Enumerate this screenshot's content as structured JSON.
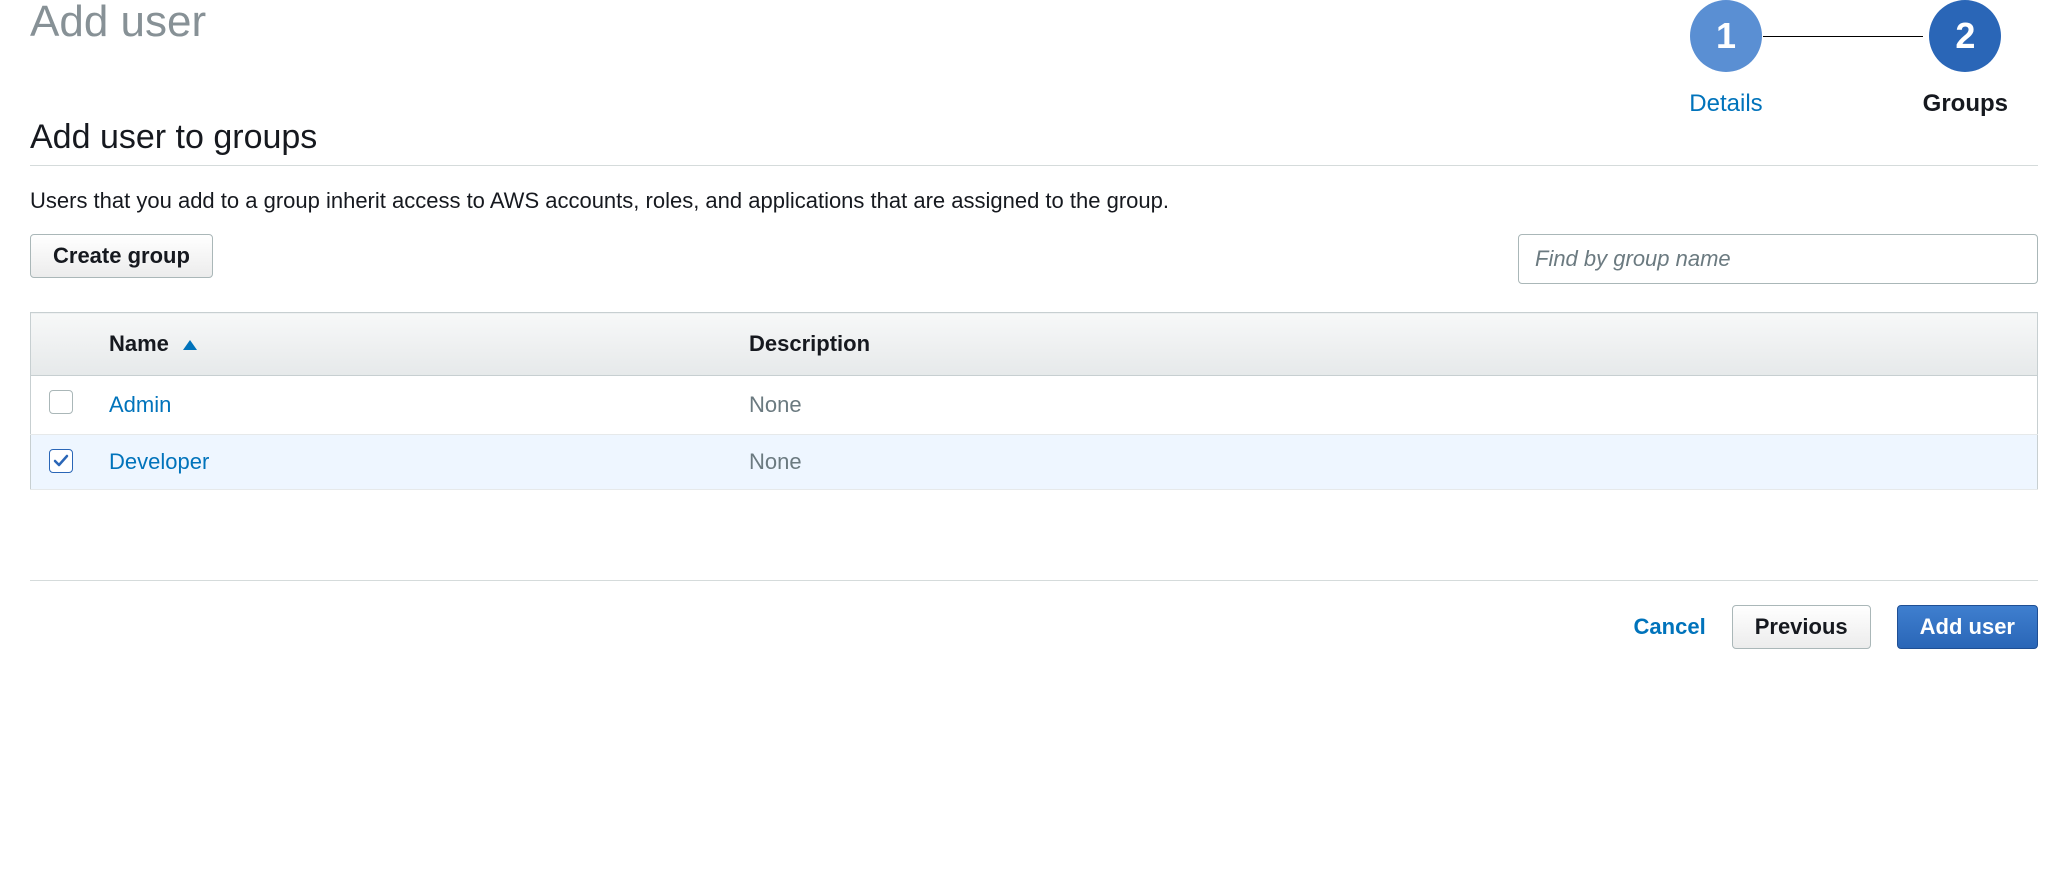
{
  "header": {
    "page_title": "Add user"
  },
  "stepper": {
    "steps": [
      {
        "number": "1",
        "label": "Details"
      },
      {
        "number": "2",
        "label": "Groups"
      }
    ],
    "active_index": 1
  },
  "section": {
    "title": "Add user to groups",
    "description": "Users that you add to a group inherit access to AWS accounts, roles, and applications that are assigned to the group."
  },
  "toolbar": {
    "create_group_label": "Create group",
    "search_placeholder": "Find by group name"
  },
  "table": {
    "columns": {
      "name": "Name",
      "description": "Description"
    },
    "sort_column": "name",
    "sort_dir": "asc",
    "rows": [
      {
        "name": "Admin",
        "description": "None",
        "selected": false
      },
      {
        "name": "Developer",
        "description": "None",
        "selected": true
      }
    ]
  },
  "footer": {
    "cancel_label": "Cancel",
    "previous_label": "Previous",
    "submit_label": "Add user"
  }
}
